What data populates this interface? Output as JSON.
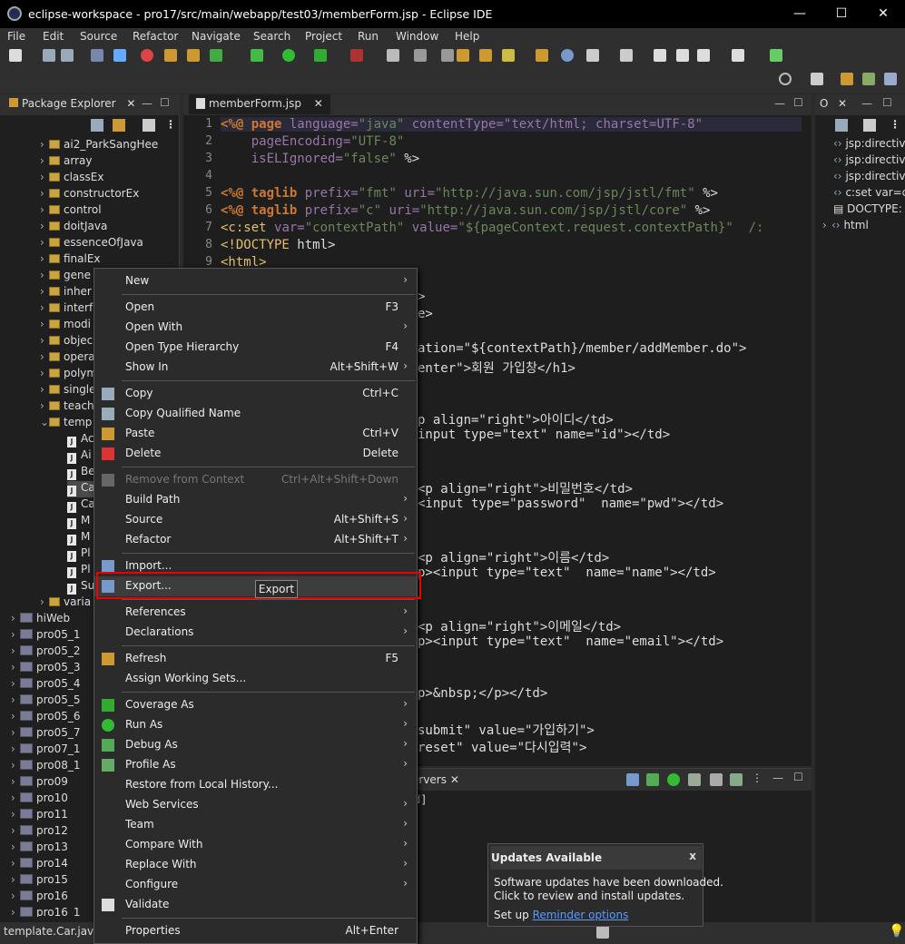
{
  "window": {
    "title": "eclipse-workspace - pro17/src/main/webapp/test03/memberForm.jsp - Eclipse IDE",
    "minimize": "—",
    "maximize": "☐",
    "close": "✕"
  },
  "menubar": [
    "File",
    "Edit",
    "Source",
    "Refactor",
    "Navigate",
    "Search",
    "Project",
    "Run",
    "Window",
    "Help"
  ],
  "package_explorer": {
    "tab": "Package Explorer",
    "items": [
      "ai2_ParkSangHee",
      "array",
      "classEx",
      "constructorEx",
      "control",
      "doitJava",
      "essenceOfJava",
      "finalEx",
      "gene",
      "inher",
      "interf",
      "modi",
      "objec",
      "opera",
      "polym",
      "single",
      "teach",
      "temp",
      "Ac",
      "Ai",
      "Be",
      "Ca",
      "Ca",
      "M",
      "M",
      "Pl",
      "Pl",
      "Su",
      "varia",
      "hiWeb",
      "pro05_1",
      "pro05_2",
      "pro05_3",
      "pro05_4",
      "pro05_5",
      "pro05_6",
      "pro05_7",
      "pro07_1",
      "pro08_1",
      "pro09",
      "pro10",
      "pro11",
      "pro12",
      "pro13",
      "pro14",
      "pro15",
      "pro16",
      "pro16_1"
    ]
  },
  "editor": {
    "tab": "memberForm.jsp",
    "lines": [
      [
        {
          "t": "<%@ ",
          "c": "kw"
        },
        {
          "t": "page ",
          "c": "kw"
        },
        {
          "t": "language=",
          "c": "attr"
        },
        {
          "t": "\"java\" ",
          "c": "str"
        },
        {
          "t": "contentType=\"text/html; charset=UTF-8\"",
          "c": "attr"
        }
      ],
      [
        {
          "t": "    pageEncoding=",
          "c": "attr"
        },
        {
          "t": "\"UTF-8\"",
          "c": "str"
        }
      ],
      [
        {
          "t": "    isELIgnored=",
          "c": "attr"
        },
        {
          "t": "\"false\" ",
          "c": "str"
        },
        {
          "t": "%>",
          "c": ""
        }
      ],
      [],
      [
        {
          "t": "<%@ ",
          "c": "kw"
        },
        {
          "t": "taglib ",
          "c": "kw"
        },
        {
          "t": "prefix=",
          "c": "attr"
        },
        {
          "t": "\"fmt\" ",
          "c": "str"
        },
        {
          "t": "uri=",
          "c": "attr"
        },
        {
          "t": "\"http://java.sun.com/jsp/jstl/fmt\" ",
          "c": "str"
        },
        {
          "t": "%>",
          "c": ""
        }
      ],
      [
        {
          "t": "<%@ ",
          "c": "kw"
        },
        {
          "t": "taglib ",
          "c": "kw"
        },
        {
          "t": "prefix=",
          "c": "attr"
        },
        {
          "t": "\"c\" ",
          "c": "str"
        },
        {
          "t": "uri=",
          "c": "attr"
        },
        {
          "t": "\"http://java.sun.com/jsp/jstl/core\" ",
          "c": "str"
        },
        {
          "t": "%>",
          "c": ""
        }
      ],
      [
        {
          "t": "<c:set ",
          "c": "tag"
        },
        {
          "t": "var=",
          "c": "attr"
        },
        {
          "t": "\"contextPath\" ",
          "c": "str"
        },
        {
          "t": "value=",
          "c": "attr"
        },
        {
          "t": "\"${pageContext.request.contextPath}\"  /:",
          "c": "str"
        }
      ],
      [
        {
          "t": "<!DOCTYPE ",
          "c": "tag"
        },
        {
          "t": "html>",
          "c": ""
        }
      ],
      [
        {
          "t": "<html>",
          "c": "tag"
        }
      ]
    ],
    "partial": [
      ">",
      "e>",
      "ation=\"${contextPath}/member/addMember.do\">",
      "enter\">회원 가입창</h1>",
      "p align=\"right\">아이디</td>",
      "input type=\"text\" name=\"id\"></td>",
      "<p align=\"right\">비밀번호</td>",
      "<input type=\"password\"  name=\"pwd\"></td>",
      "<p align=\"right\">이름</td>",
      "p><input type=\"text\"  name=\"name\"></td>",
      "<p align=\"right\">이메일</td>",
      "p><input type=\"text\"  name=\"email\"></td>",
      "p>&nbsp;</p></td>",
      "submit\" value=\"가입하기\">",
      "reset\" value=\"다시입력\">"
    ]
  },
  "outline": {
    "items": [
      "jsp:directive",
      "jsp:directive",
      "jsp:directive",
      "c:set var=c",
      "DOCTYPE:",
      "html"
    ]
  },
  "console": {
    "tab": "ervers",
    "text": "d]"
  },
  "context_menu": {
    "items": [
      {
        "label": "New",
        "sub": true
      },
      {
        "sep": true
      },
      {
        "label": "Open",
        "sc": "F3"
      },
      {
        "label": "Open With",
        "sub": true
      },
      {
        "label": "Open Type Hierarchy",
        "sc": "F4"
      },
      {
        "label": "Show In",
        "sc": "Alt+Shift+W",
        "sub": true
      },
      {
        "sep": true
      },
      {
        "label": "Copy",
        "sc": "Ctrl+C",
        "icon": "copy-icon"
      },
      {
        "label": "Copy Qualified Name",
        "icon": "copy-icon"
      },
      {
        "label": "Paste",
        "sc": "Ctrl+V",
        "icon": "paste-icon"
      },
      {
        "label": "Delete",
        "sc": "Delete",
        "icon": "delete-icon"
      },
      {
        "sep": true
      },
      {
        "label": "Remove from Context",
        "sc": "Ctrl+Alt+Shift+Down",
        "disabled": true,
        "icon": "remove-context-icon"
      },
      {
        "label": "Build Path",
        "sub": true
      },
      {
        "label": "Source",
        "sc": "Alt+Shift+S",
        "sub": true
      },
      {
        "label": "Refactor",
        "sc": "Alt+Shift+T",
        "sub": true
      },
      {
        "sep": true
      },
      {
        "label": "Import...",
        "icon": "import-icon"
      },
      {
        "label": "Export...",
        "icon": "export-icon",
        "highlight": true
      },
      {
        "sep": true
      },
      {
        "label": "References",
        "sub": true
      },
      {
        "label": "Declarations",
        "sub": true
      },
      {
        "sep": true
      },
      {
        "label": "Refresh",
        "sc": "F5",
        "icon": "refresh-icon"
      },
      {
        "label": "Assign Working Sets..."
      },
      {
        "sep": true
      },
      {
        "label": "Coverage As",
        "sub": true,
        "icon": "coverage-icon"
      },
      {
        "label": "Run As",
        "sub": true,
        "icon": "run-icon"
      },
      {
        "label": "Debug As",
        "sub": true,
        "icon": "debug-icon"
      },
      {
        "label": "Profile As",
        "sub": true,
        "icon": "profile-icon"
      },
      {
        "label": "Restore from Local History..."
      },
      {
        "label": "Web Services",
        "sub": true
      },
      {
        "label": "Team",
        "sub": true
      },
      {
        "label": "Compare With",
        "sub": true
      },
      {
        "label": "Replace With",
        "sub": true
      },
      {
        "label": "Configure",
        "sub": true
      },
      {
        "label": "Validate",
        "icon": "check-icon"
      },
      {
        "sep": true
      },
      {
        "label": "Properties",
        "sc": "Alt+Enter"
      }
    ]
  },
  "tooltip": "Export",
  "notification": {
    "title": "Updates Available",
    "body1": "Software updates have been downloaded.",
    "body2": "Click to review and install updates.",
    "setup": "Set up ",
    "link": "Reminder options",
    "close": "x"
  },
  "status": {
    "selected": "template.Car.java - "
  },
  "colors": {
    "highlight_red": "#e00000",
    "link": "#5a9bff"
  }
}
